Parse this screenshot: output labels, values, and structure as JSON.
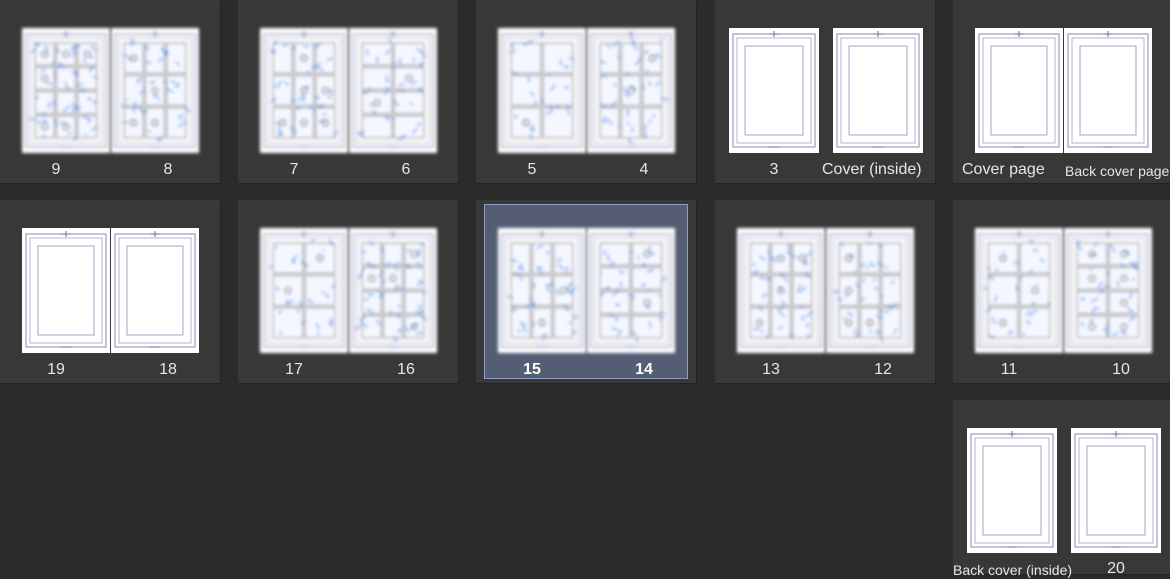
{
  "spreads": [
    {
      "left": "9",
      "right": "8"
    },
    {
      "left": "7",
      "right": "6"
    },
    {
      "left": "5",
      "right": "4"
    },
    {
      "left": "3",
      "right": "Cover (inside)"
    },
    {
      "left": "Cover page",
      "right": "Back cover page"
    },
    {
      "left": "19",
      "right": "18"
    },
    {
      "left": "17",
      "right": "16"
    },
    {
      "left": "15",
      "right": "14"
    },
    {
      "left": "13",
      "right": "12"
    },
    {
      "left": "11",
      "right": "10"
    },
    {
      "left": "Back cover (inside)",
      "right": "20"
    }
  ],
  "selected_spread": "15-14",
  "colors": {
    "background": "#2b2b2b",
    "tile": "#383838",
    "selection": "#6f7fa8",
    "sketch": "#4a86e8"
  }
}
